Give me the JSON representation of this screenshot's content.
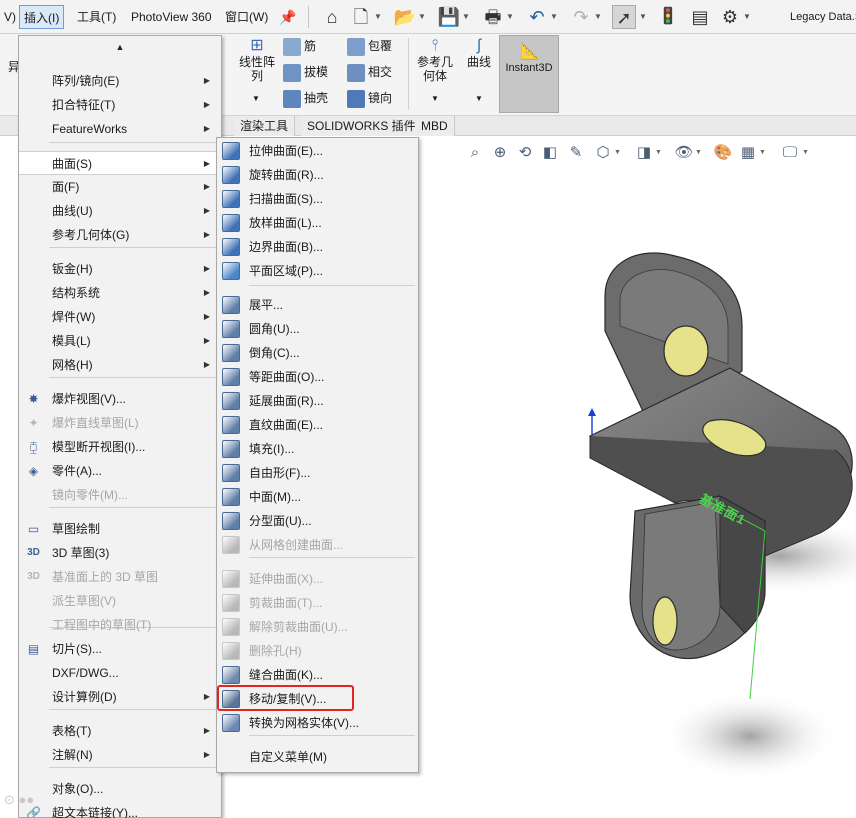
{
  "menubar": {
    "items": [
      {
        "label": "V)"
      },
      {
        "label": "插入(I)"
      },
      {
        "label": "工具(T)"
      },
      {
        "label": "PhotoView 360"
      },
      {
        "label": "窗口(W)"
      }
    ],
    "right_title": "Legacy Data.S"
  },
  "ribbon": {
    "col1": [
      "筋",
      "拔模",
      "抽壳"
    ],
    "col2": [
      "包覆",
      "相交",
      "镜向"
    ],
    "linear_pattern": "线性阵\n列",
    "partial_left": "异",
    "ref_geometry": "参考几\n何体",
    "curves": "曲线",
    "instant3d": "Instant3D"
  },
  "tabs": [
    "渲染工具",
    "SOLIDWORKS 插件",
    "MBD"
  ],
  "main_menu": {
    "items": [
      {
        "label": "阵列/镜向(E)",
        "arrow": true,
        "icon": "",
        "disabled": false
      },
      {
        "label": "扣合特征(T)",
        "arrow": true,
        "icon": "",
        "disabled": false
      },
      {
        "label": "FeatureWorks",
        "arrow": true,
        "icon": "",
        "disabled": false
      },
      {
        "label": "曲面(S)",
        "arrow": true,
        "icon": "",
        "disabled": false
      },
      {
        "label": "面(F)",
        "arrow": true,
        "icon": "",
        "disabled": false
      },
      {
        "label": "曲线(U)",
        "arrow": true,
        "icon": "",
        "disabled": false
      },
      {
        "label": "参考几何体(G)",
        "arrow": true,
        "icon": "",
        "disabled": false
      },
      {
        "label": "钣金(H)",
        "arrow": true,
        "icon": "",
        "disabled": false
      },
      {
        "label": "结构系统",
        "arrow": true,
        "icon": "",
        "disabled": false
      },
      {
        "label": "焊件(W)",
        "arrow": true,
        "icon": "",
        "disabled": false
      },
      {
        "label": "模具(L)",
        "arrow": true,
        "icon": "",
        "disabled": false
      },
      {
        "label": "网格(H)",
        "arrow": true,
        "icon": "",
        "disabled": false
      },
      {
        "label": "爆炸视图(V)...",
        "arrow": false,
        "icon": "explode-view-icon",
        "disabled": false
      },
      {
        "label": "爆炸直线草图(L)",
        "arrow": false,
        "icon": "explode-line-icon",
        "disabled": true
      },
      {
        "label": "模型断开视图(I)...",
        "arrow": false,
        "icon": "break-view-icon",
        "disabled": false
      },
      {
        "label": "零件(A)...",
        "arrow": false,
        "icon": "part-icon",
        "disabled": false
      },
      {
        "label": "镜向零件(M)...",
        "arrow": false,
        "icon": "",
        "disabled": true
      },
      {
        "label": "草图绘制",
        "arrow": false,
        "icon": "sketch-icon",
        "disabled": false
      },
      {
        "label": "3D 草图(3)",
        "arrow": false,
        "icon": "3d-sketch-icon",
        "disabled": false
      },
      {
        "label": "基准面上的 3D 草图",
        "arrow": false,
        "icon": "3d-sketch-plane-icon",
        "disabled": true
      },
      {
        "label": "派生草图(V)",
        "arrow": false,
        "icon": "",
        "disabled": true
      },
      {
        "label": "工程图中的草图(T)",
        "arrow": false,
        "icon": "",
        "disabled": true
      },
      {
        "label": "切片(S)...",
        "arrow": false,
        "icon": "slice-icon",
        "disabled": false
      },
      {
        "label": "DXF/DWG...",
        "arrow": false,
        "icon": "",
        "disabled": false
      },
      {
        "label": "设计算例(D)",
        "arrow": true,
        "icon": "",
        "disabled": false
      },
      {
        "label": "表格(T)",
        "arrow": true,
        "icon": "",
        "disabled": false
      },
      {
        "label": "注解(N)",
        "arrow": true,
        "icon": "",
        "disabled": false
      },
      {
        "label": "对象(O)...",
        "arrow": false,
        "icon": "",
        "disabled": false
      },
      {
        "label": "超文本链接(Y)...",
        "arrow": false,
        "icon": "hyperlink-icon",
        "disabled": false
      }
    ]
  },
  "surface_menu": {
    "items": [
      {
        "label": "拉伸曲面(E)...",
        "icon": "extrude-surface-icon",
        "disabled": false
      },
      {
        "label": "旋转曲面(R)...",
        "icon": "revolve-surface-icon",
        "disabled": false
      },
      {
        "label": "扫描曲面(S)...",
        "icon": "sweep-surface-icon",
        "disabled": false
      },
      {
        "label": "放样曲面(L)...",
        "icon": "loft-surface-icon",
        "disabled": false
      },
      {
        "label": "边界曲面(B)...",
        "icon": "boundary-surface-icon",
        "disabled": false
      },
      {
        "label": "平面区域(P)...",
        "icon": "planar-surface-icon",
        "disabled": false
      },
      {
        "label": "展平...",
        "icon": "flatten-icon",
        "disabled": false
      },
      {
        "label": "圆角(U)...",
        "icon": "fillet-icon",
        "disabled": false
      },
      {
        "label": "倒角(C)...",
        "icon": "chamfer-icon",
        "disabled": false
      },
      {
        "label": "等距曲面(O)...",
        "icon": "offset-surface-icon",
        "disabled": false
      },
      {
        "label": "延展曲面(R)...",
        "icon": "radiate-surface-icon",
        "disabled": false
      },
      {
        "label": "直纹曲面(E)...",
        "icon": "ruled-surface-icon",
        "disabled": false
      },
      {
        "label": "填充(I)...",
        "icon": "fill-surface-icon",
        "disabled": false
      },
      {
        "label": "自由形(F)...",
        "icon": "freeform-icon",
        "disabled": false
      },
      {
        "label": "中面(M)...",
        "icon": "mid-surface-icon",
        "disabled": false
      },
      {
        "label": "分型面(U)...",
        "icon": "parting-surface-icon",
        "disabled": false
      },
      {
        "label": "从网格创建曲面...",
        "icon": "mesh-surface-icon",
        "disabled": true
      },
      {
        "label": "延伸曲面(X)...",
        "icon": "extend-surface-icon",
        "disabled": true
      },
      {
        "label": "剪裁曲面(T)...",
        "icon": "trim-surface-icon",
        "disabled": true
      },
      {
        "label": "解除剪裁曲面(U)...",
        "icon": "untrim-surface-icon",
        "disabled": true
      },
      {
        "label": "删除孔(H)",
        "icon": "delete-hole-icon",
        "disabled": true
      },
      {
        "label": "缝合曲面(K)...",
        "icon": "knit-surface-icon",
        "disabled": false
      },
      {
        "label": "移动/复制(V)...",
        "icon": "move-copy-icon",
        "disabled": false
      },
      {
        "label": "转换为网格实体(V)...",
        "icon": "convert-mesh-icon",
        "disabled": false
      },
      {
        "label": "自定义菜单(M)",
        "icon": "",
        "disabled": false
      }
    ]
  },
  "model": {
    "engraved_text": "基准面1"
  },
  "colors": {
    "menu_bg": "#f2f2f2",
    "highlight_box": "#e0261f",
    "model_body": "#6e6e6e",
    "model_holes": "#e6e28c",
    "engrave_green": "#4fd14f"
  }
}
